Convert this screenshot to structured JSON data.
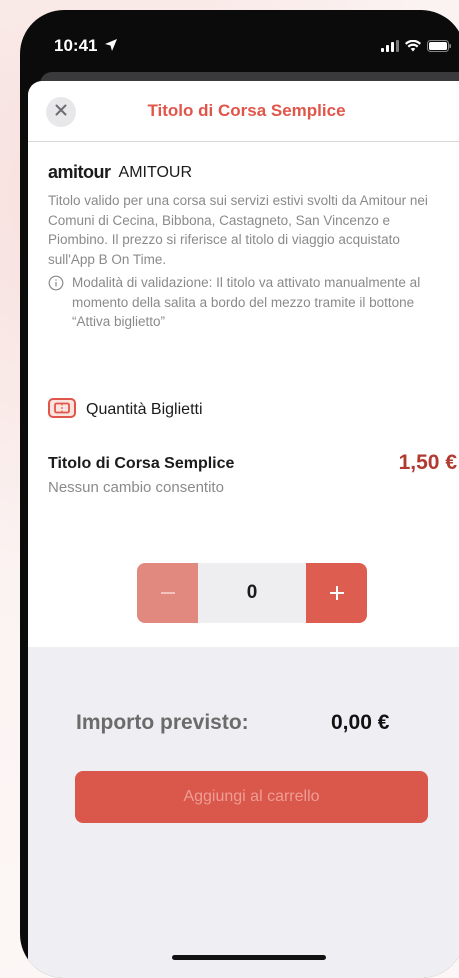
{
  "status": {
    "time": "10:41"
  },
  "nav": {
    "title": "Titolo di Corsa Semplice"
  },
  "operator": {
    "logo_text": "amitour",
    "name": "AMITOUR"
  },
  "description": "Titolo valido per una corsa sui servizi estivi svolti da Amitour nei Comuni di Cecina, Bibbona, Castagneto, San Vincenzo e Piombino. Il prezzo si riferisce al titolo di viaggio acquistato sull'App B On Time.",
  "validation_note": "Modalità di validazione: Il titolo va attivato manualmente al momento della salita a bordo del mezzo tramite il bottone “Attiva biglietto”",
  "quantity": {
    "section_title": "Quantità Biglietti",
    "ticket_name": "Titolo di Corsa Semplice",
    "ticket_price": "1,50 €",
    "ticket_subtitle": "Nessun cambio consentito",
    "value": "0",
    "minus_symbol": "−",
    "plus_symbol": "+"
  },
  "summary": {
    "label": "Importo previsto:",
    "amount": "0,00 €",
    "cart_button": "Aggiungi al carrello"
  },
  "colors": {
    "accent": "#e0564a",
    "price": "#b13a31",
    "button": "#d9574b"
  },
  "icons": {
    "close": "close-icon",
    "info": "info-icon",
    "ticket": "ticket-icon",
    "location": "location-arrow-icon",
    "signal": "signal-icon",
    "wifi": "wifi-icon",
    "battery": "battery-icon"
  }
}
